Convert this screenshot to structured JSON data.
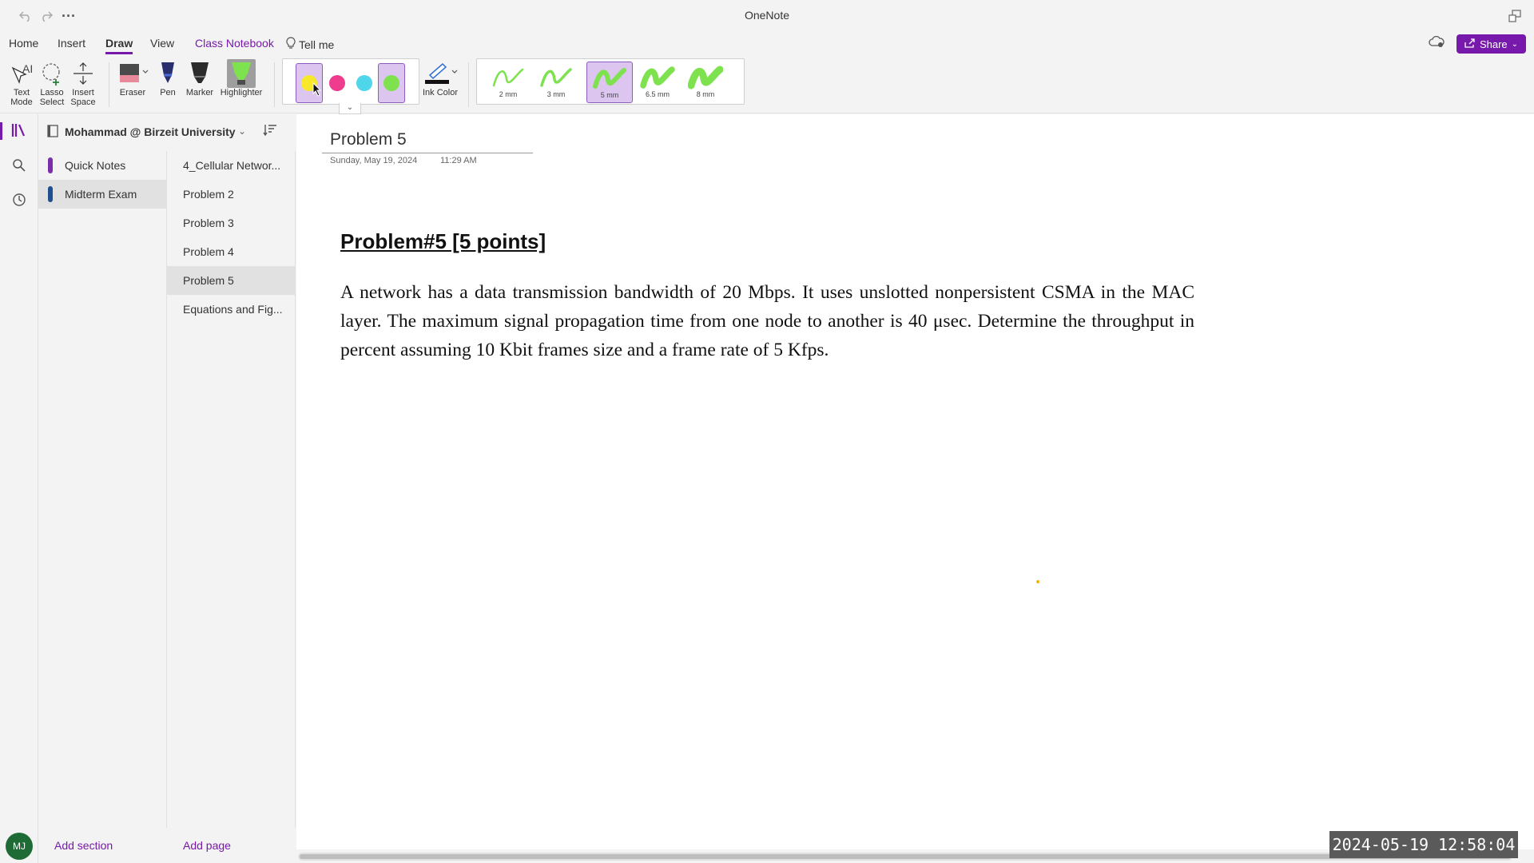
{
  "app": {
    "title": "OneNote"
  },
  "menu": {
    "tabs": [
      {
        "label": "Home"
      },
      {
        "label": "Insert"
      },
      {
        "label": "Draw"
      },
      {
        "label": "View"
      },
      {
        "label": "Class Notebook"
      },
      {
        "label": "Tell me"
      }
    ],
    "active_tab": "Draw",
    "share_label": "Share"
  },
  "ribbon": {
    "tools": {
      "text_mode": "Text Mode",
      "lasso_select": "Lasso Select",
      "insert_space": "Insert Space",
      "eraser": "Eraser",
      "pen": "Pen",
      "marker": "Marker",
      "highlighter": "Highlighter",
      "ink_color": "Ink Color"
    },
    "colors": [
      {
        "name": "yellow",
        "hex": "#f7e92a",
        "selected": true
      },
      {
        "name": "pink",
        "hex": "#ee3d8f",
        "selected": false
      },
      {
        "name": "cyan",
        "hex": "#4fd6ea",
        "selected": false
      },
      {
        "name": "green",
        "hex": "#7ee24e",
        "selected": true
      }
    ],
    "sizes": [
      {
        "label": "2 mm"
      },
      {
        "label": "3 mm"
      },
      {
        "label": "5 mm",
        "selected": true
      },
      {
        "label": "6.5 mm"
      },
      {
        "label": "8 mm"
      }
    ],
    "accent_color": "#7719aa",
    "highlight_green": "#7ee24e"
  },
  "notebook": {
    "name": "Mohammad @ Birzeit University",
    "sections": [
      {
        "label": "Quick Notes",
        "color": "#7a2fa8"
      },
      {
        "label": "Midterm Exam",
        "color": "#1f4f8f",
        "selected": true
      }
    ],
    "add_section": "Add section",
    "pages": [
      {
        "label": "4_Cellular Networ..."
      },
      {
        "label": "Problem 2"
      },
      {
        "label": "Problem 3"
      },
      {
        "label": "Problem 4"
      },
      {
        "label": "Problem 5",
        "selected": true
      },
      {
        "label": "Equations and Fig..."
      }
    ],
    "add_page": "Add page"
  },
  "page": {
    "title": "Problem 5",
    "date": "Sunday, May 19, 2024",
    "time": "11:29 AM",
    "heading": "Problem#5 [5 points]",
    "body": "A network has a data transmission bandwidth of 20 Mbps. It uses unslotted nonpersistent CSMA in the MAC layer. The maximum signal propagation time from one node to another is 40 μsec. Determine the throughput in percent assuming 10 Kbit frames size and a frame rate of 5 Kfps."
  },
  "user": {
    "initials": "MJ"
  },
  "overlay": {
    "timestamp": "2024-05-19 12:58:04"
  }
}
